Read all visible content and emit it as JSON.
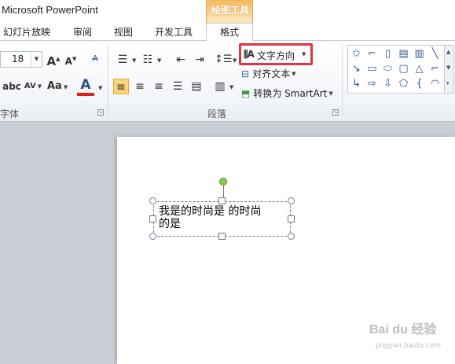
{
  "app": {
    "title": "Microsoft PowerPoint"
  },
  "context_tab": {
    "group_label": "绘图工具"
  },
  "tabs": [
    {
      "label": "幻灯片放映"
    },
    {
      "label": "审阅"
    },
    {
      "label": "视图"
    },
    {
      "label": "开发工具"
    },
    {
      "label": "格式"
    }
  ],
  "ribbon": {
    "font": {
      "group_label": "字体",
      "font_size": "18",
      "grow_font": "A",
      "shrink_font": "A",
      "clear_format": "A",
      "change_case": "Aa",
      "spacing": "AV",
      "font_color": "A",
      "abc": "abc"
    },
    "paragraph": {
      "group_label": "段落",
      "text_direction": "文字方向",
      "align_text": "对齐文本",
      "convert_smartart": "转换为 SmartArt"
    }
  },
  "textbox": {
    "line1": "我是的时尚是 的时尚",
    "line2": "的是"
  },
  "watermark": {
    "main": "Bai du 经验",
    "sub": "jingyan.baidu.com"
  },
  "colors": {
    "highlight_border": "#e1343e",
    "context_tab": "#f6b75d",
    "rotation_handle": "#7cd24a"
  }
}
